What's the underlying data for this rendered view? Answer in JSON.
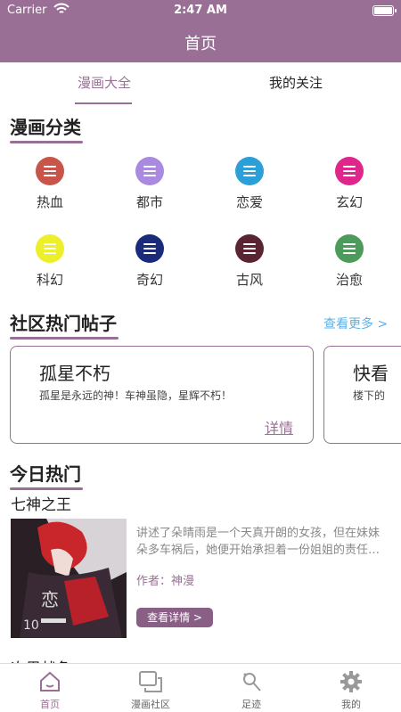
{
  "status_bar": {
    "carrier": "Carrier",
    "time": "2:47 AM"
  },
  "nav": {
    "title": "首页"
  },
  "tabs": [
    {
      "label": "漫画大全",
      "active": true
    },
    {
      "label": "我的关注",
      "active": false
    }
  ],
  "categories": {
    "title": "漫画分类",
    "items": [
      {
        "label": "热血",
        "color": "#c9554a"
      },
      {
        "label": "都市",
        "color": "#a98ae0"
      },
      {
        "label": "恋爱",
        "color": "#2b9fd8"
      },
      {
        "label": "玄幻",
        "color": "#e0268a"
      },
      {
        "label": "科幻",
        "color": "#ecef2a"
      },
      {
        "label": "奇幻",
        "color": "#1b2a7a"
      },
      {
        "label": "古风",
        "color": "#5a2432"
      },
      {
        "label": "治愈",
        "color": "#4d9b5a"
      }
    ]
  },
  "community": {
    "title": "社区热门帖子",
    "more_label": "查看更多 >",
    "posts": [
      {
        "title": "孤星不朽",
        "desc": "孤星是永远的神！车神虽隐，星辉不朽！",
        "detail_label": "详情"
      },
      {
        "title": "快看",
        "desc": "楼下的",
        "detail_label": ""
      }
    ]
  },
  "today_hot": {
    "title": "今日热门",
    "book": {
      "title": "七神之王",
      "desc": "讲述了朵晴雨是一个天真开朗的女孩，但在妹妹朵多车祸后，她便开始承担着一份姐姐的责任…",
      "author": "作者：神漫",
      "button": "查看详情 >"
    },
    "next_title": "次男战争"
  },
  "tabbar": [
    {
      "label": "首页",
      "icon": "home-icon",
      "active": true
    },
    {
      "label": "漫画社区",
      "icon": "chat-bubbles-icon",
      "active": false
    },
    {
      "label": "足迹",
      "icon": "footprint-icon",
      "active": false
    },
    {
      "label": "我的",
      "icon": "gear-icon",
      "active": false
    }
  ],
  "colors": {
    "accent": "#9a6f96",
    "link": "#5fb0e6"
  }
}
